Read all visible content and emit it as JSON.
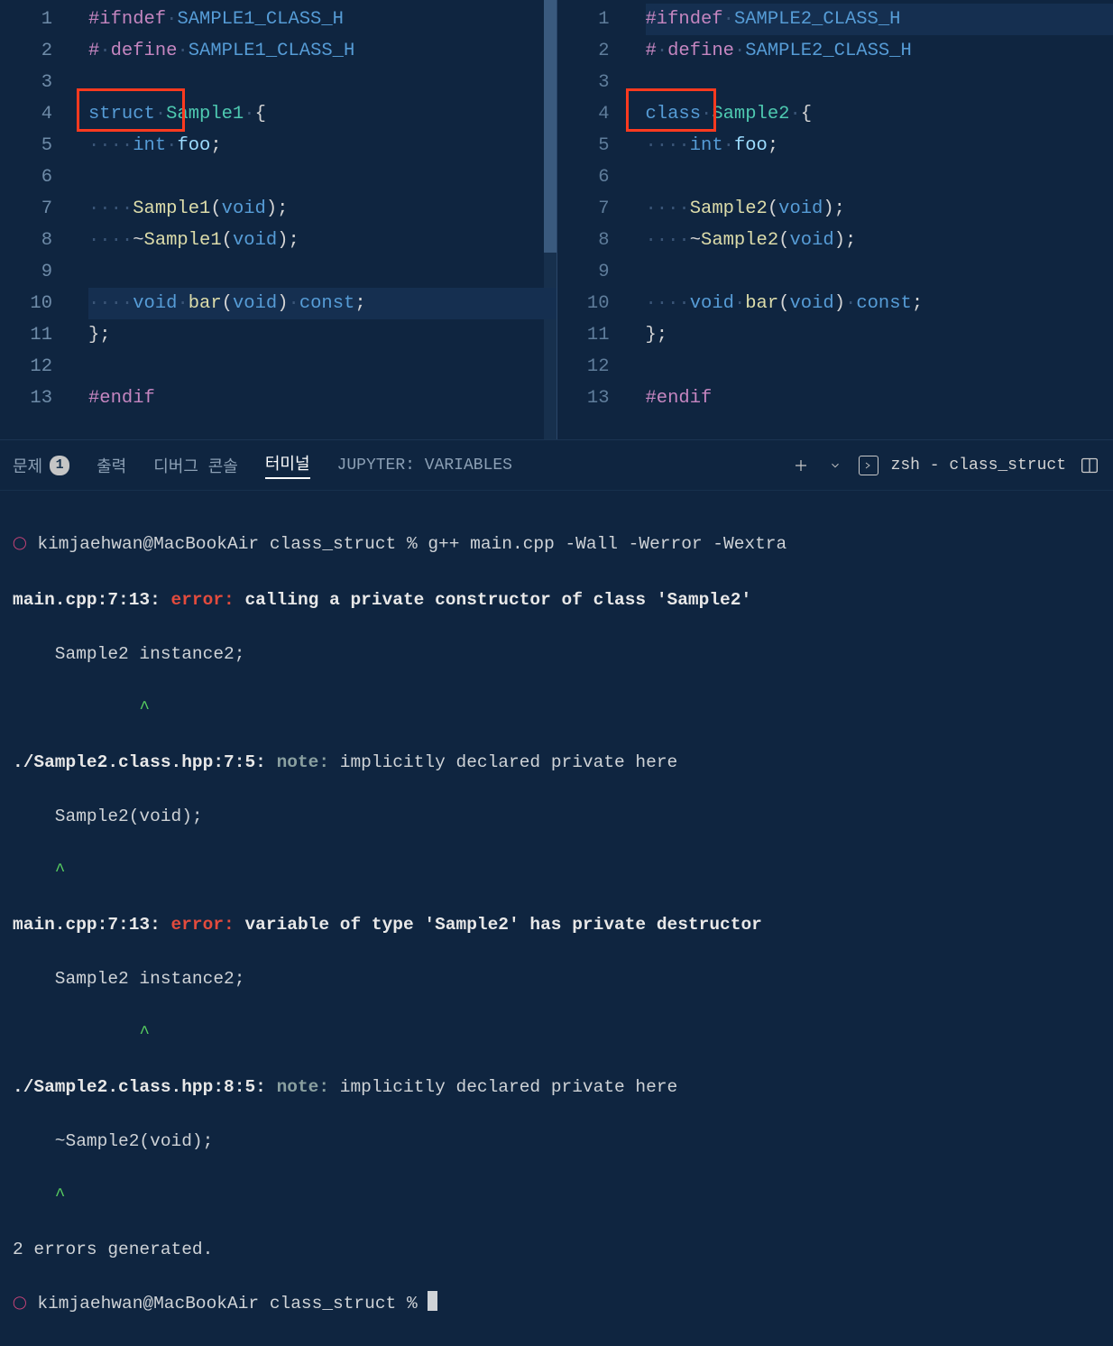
{
  "editor": {
    "left": {
      "gutter": [
        "1",
        "2",
        "3",
        "4",
        "5",
        "6",
        "7",
        "8",
        "9",
        "10",
        "11",
        "12",
        "13"
      ],
      "tokens": {
        "l1_ifndef": "#ifndef",
        "l1_macro": "SAMPLE1_CLASS_H",
        "l2_hash": "#",
        "l2_define": "define",
        "l2_macro": "SAMPLE1_CLASS_H",
        "l4_struct": "struct",
        "l4_name": "Sample1",
        "l4_brace": "{",
        "l5_int": "int",
        "l5_foo": "foo",
        "l5_semi": ";",
        "l7_ctor": "Sample1",
        "l7_lp": "(",
        "l7_void": "void",
        "l7_rpsemi": ");",
        "l8_tilde": "~",
        "l8_dtor": "Sample1",
        "l8_lp": "(",
        "l8_void": "void",
        "l8_rpsemi": ");",
        "l10_void1": "void",
        "l10_bar": "bar",
        "l10_lp": "(",
        "l10_void2": "void",
        "l10_rp": ")",
        "l10_const": "const",
        "l10_semi": ";",
        "l11_close": "};",
        "l13_endif": "#endif",
        "dot2": "··",
        "dot4": "····"
      }
    },
    "right": {
      "gutter": [
        "1",
        "2",
        "3",
        "4",
        "5",
        "6",
        "7",
        "8",
        "9",
        "10",
        "11",
        "12",
        "13"
      ],
      "tokens": {
        "l1_ifndef": "#ifndef",
        "l1_macro": "SAMPLE2_CLASS_H",
        "l2_hash": "#",
        "l2_define": "define",
        "l2_macro": "SAMPLE2_CLASS_H",
        "l4_class": "class",
        "l4_name": "Sample2",
        "l4_brace": "{",
        "l5_int": "int",
        "l5_foo": "foo",
        "l5_semi": ";",
        "l7_ctor": "Sample2",
        "l7_lp": "(",
        "l7_void": "void",
        "l7_rpsemi": ");",
        "l8_tilde": "~",
        "l8_dtor": "Sample2",
        "l8_lp": "(",
        "l8_void": "void",
        "l8_rpsemi": ");",
        "l10_void1": "void",
        "l10_bar": "bar",
        "l10_lp": "(",
        "l10_void2": "void",
        "l10_rp": ")",
        "l10_const": "const",
        "l10_semi": ";",
        "l11_close": "};",
        "l13_endif": "#endif",
        "dot2": "··",
        "dot4": "····"
      }
    }
  },
  "panel": {
    "tabs": {
      "problems": "문제",
      "problems_count": "1",
      "output": "출력",
      "debug": "디버그 콘솔",
      "terminal": "터미널",
      "jupyter": "JUPYTER: VARIABLES"
    },
    "shell_label": "zsh - class_struct"
  },
  "terminal": {
    "p0": "kimjaehwan@MacBookAir class_struct % g++ main.cpp -Wall -Werror -Wextra",
    "e1_loc": "main.cpp:7:13: ",
    "e1_err": "error: ",
    "e1_msg": "calling a private constructor of class 'Sample2'",
    "e1_code": "    Sample2 instance2;",
    "e1_caret": "            ^",
    "n1_loc": "./Sample2.class.hpp:7:5: ",
    "n1_note": "note: ",
    "n1_msg": "implicitly declared private here",
    "n1_code": "    Sample2(void);",
    "n1_caret": "    ^",
    "e2_loc": "main.cpp:7:13: ",
    "e2_err": "error: ",
    "e2_msg": "variable of type 'Sample2' has private destructor",
    "e2_code": "    Sample2 instance2;",
    "e2_caret": "            ^",
    "n2_loc": "./Sample2.class.hpp:8:5: ",
    "n2_note": "note: ",
    "n2_msg": "implicitly declared private here",
    "n2_code": "    ~Sample2(void);",
    "n2_caret": "    ^",
    "summary": "2 errors generated.",
    "p1": "kimjaehwan@MacBookAir class_struct % "
  }
}
